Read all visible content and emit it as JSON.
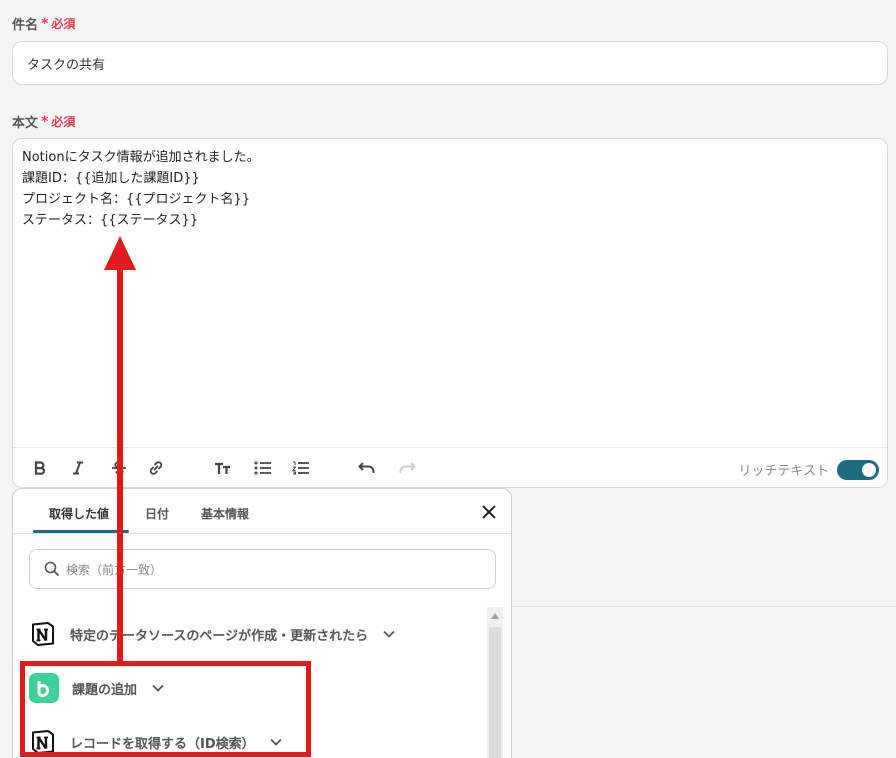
{
  "subject": {
    "label": "件名",
    "required_mark": "*",
    "required_text": "必須",
    "value": "タスクの共有"
  },
  "body": {
    "label": "本文",
    "required_mark": "*",
    "required_text": "必須",
    "lines": [
      "Notionにタスク情報が追加されました。",
      "課題ID：{{追加した課題ID}}",
      "プロジェクト名：{{プロジェクト名}}",
      "ステータス：{{ステータス}}"
    ],
    "toolbar": {
      "icons": [
        "bold-icon",
        "italic-icon",
        "strikethrough-icon",
        "link-icon",
        "text-size-icon",
        "bullet-list-icon",
        "numbered-list-icon",
        "undo-icon",
        "redo-icon"
      ],
      "rich_text_label": "リッチテキスト",
      "rich_text_enabled": true,
      "accent_color": "#1d6b80"
    }
  },
  "panel": {
    "tabs": [
      {
        "label": "取得した値",
        "active": true
      },
      {
        "label": "日付",
        "active": false
      },
      {
        "label": "基本情報",
        "active": false
      }
    ],
    "search_placeholder": "検索（前方一致）",
    "items": [
      {
        "label": "特定のデータソースのページが作成・更新されたら",
        "icon": "notion-icon"
      },
      {
        "label": "課題の追加",
        "icon": "backlog-icon"
      },
      {
        "label": "レコードを取得する（ID検索）",
        "icon": "notion-icon"
      }
    ]
  },
  "annotation_color": "#e11b1b"
}
